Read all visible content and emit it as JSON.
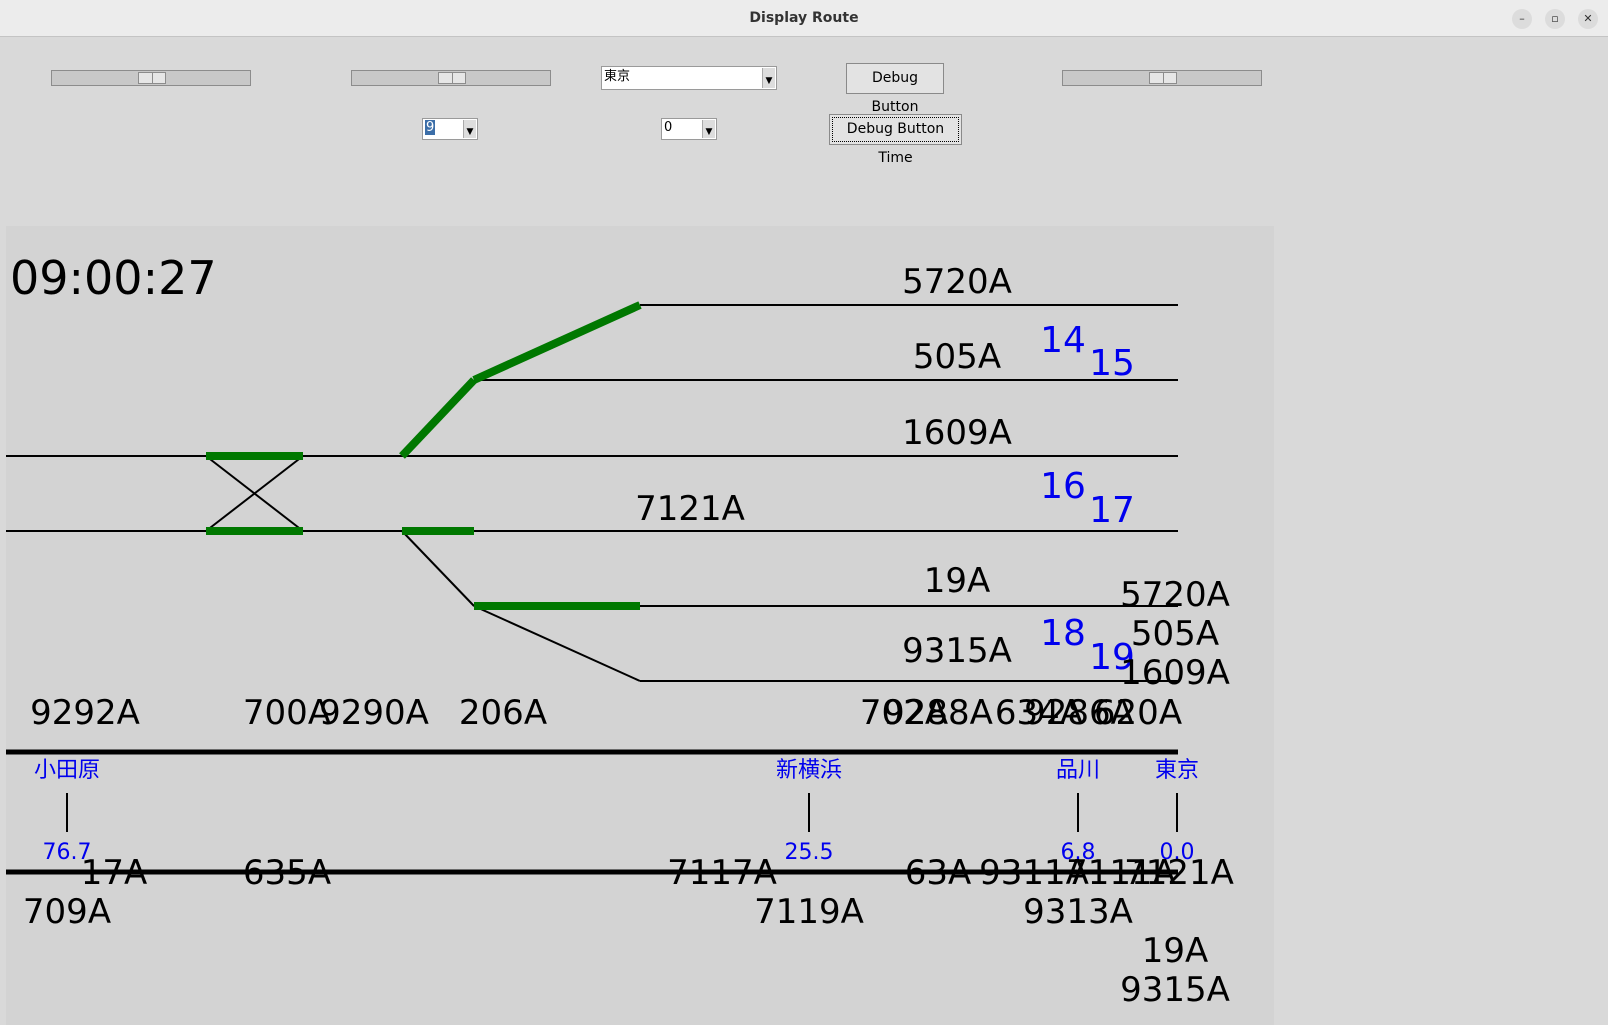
{
  "window": {
    "title": "Display Route",
    "minimize_icon": "–",
    "maximize_icon": "▫",
    "close_icon": "✕"
  },
  "controls": {
    "slider1_value": 0.5,
    "slider2_value": 0.5,
    "slider3_value": 0.5,
    "station_select": "東京",
    "hour_select": "9",
    "minute_select": "0",
    "debug_button": "Debug Button",
    "debug_time_button": "Debug Button Time"
  },
  "colors": {
    "route": "#007800",
    "track": "#000000",
    "platform": "#0000ee",
    "station": "#0000ee"
  },
  "display": {
    "clock": "09:00:27",
    "track_trains": [
      "5720A",
      "505A",
      "1609A",
      "7121A",
      "19A",
      "9315A"
    ],
    "platforms": [
      "14",
      "15",
      "16",
      "17",
      "18",
      "19"
    ],
    "queue_right": [
      "5720A",
      "505A",
      "1609A"
    ],
    "upper_line_trains": [
      "9292A",
      "700A",
      "9290A",
      "206A",
      "702A",
      "9288A",
      "634A",
      "9286A",
      "620A"
    ],
    "stations": [
      {
        "name": "小田原",
        "km": "76.7"
      },
      {
        "name": "新横浜",
        "km": "25.5"
      },
      {
        "name": "品川",
        "km": "6.8"
      },
      {
        "name": "東京",
        "km": "0.0"
      }
    ],
    "lower_line_trains": [
      "17A",
      "709A",
      "635A",
      "7117A",
      "7119A",
      "63A",
      "9311A",
      "7111A",
      "9313A",
      "7121A",
      "19A",
      "9315A"
    ]
  }
}
